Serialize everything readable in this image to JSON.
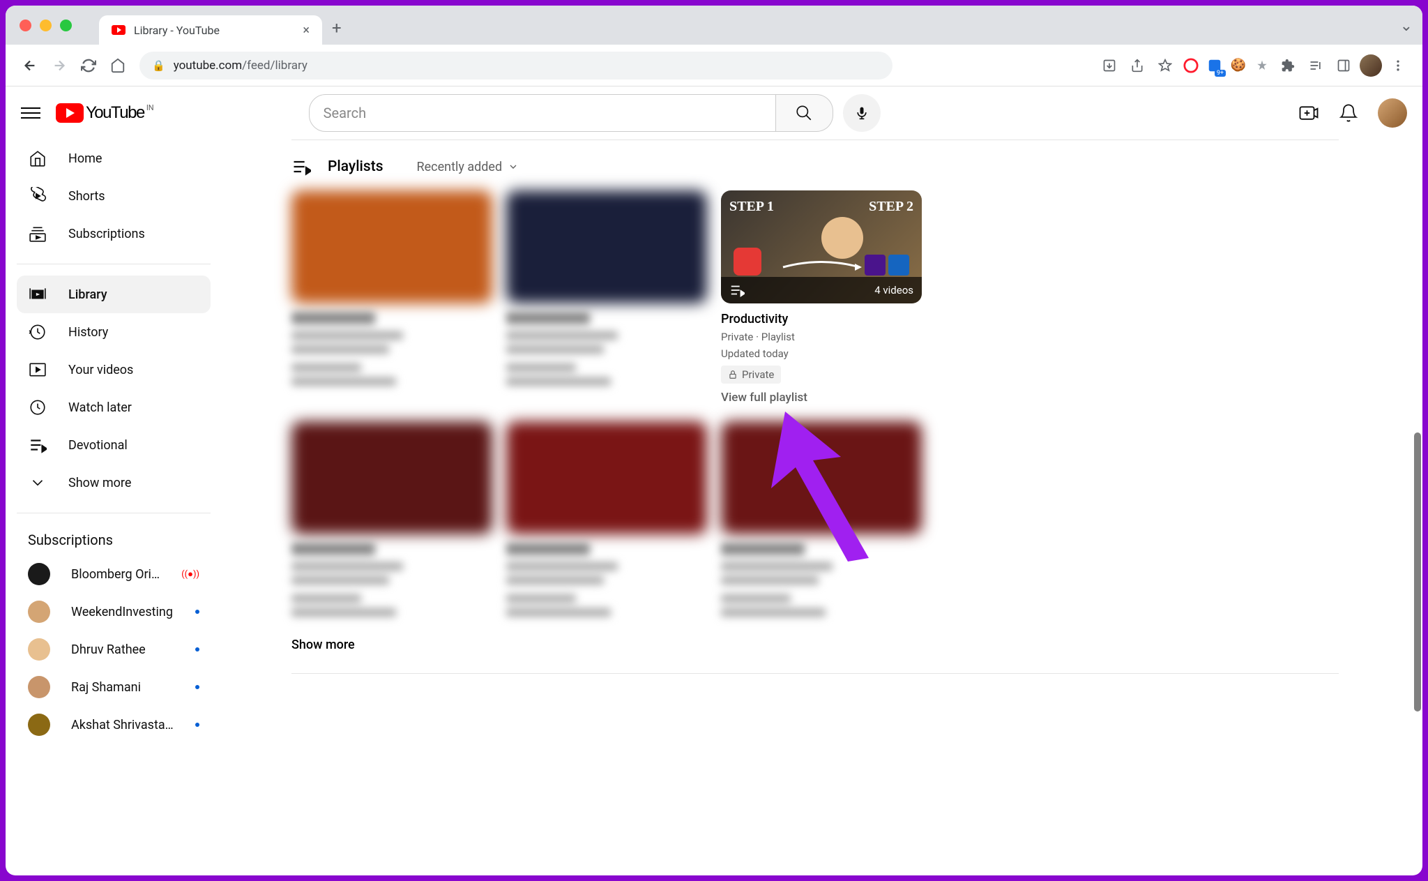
{
  "browser": {
    "tab_title": "Library - YouTube",
    "url_domain": "youtube.com",
    "url_path": "/feed/library"
  },
  "header": {
    "logo_text": "YouTube",
    "country_code": "IN",
    "search_placeholder": "Search"
  },
  "sidebar": {
    "nav": [
      {
        "icon": "home",
        "label": "Home"
      },
      {
        "icon": "shorts",
        "label": "Shorts"
      },
      {
        "icon": "subscriptions",
        "label": "Subscriptions"
      }
    ],
    "you": [
      {
        "icon": "library",
        "label": "Library",
        "active": true
      },
      {
        "icon": "history",
        "label": "History"
      },
      {
        "icon": "your-videos",
        "label": "Your videos"
      },
      {
        "icon": "watch-later",
        "label": "Watch later"
      },
      {
        "icon": "playlist",
        "label": "Devotional"
      },
      {
        "icon": "chevron-down",
        "label": "Show more"
      }
    ],
    "subs_heading": "Subscriptions",
    "subs": [
      {
        "name": "Bloomberg Origi...",
        "color": "#1a1a1a",
        "status": "live"
      },
      {
        "name": "WeekendInvesting",
        "color": "#d4a574",
        "status": "new"
      },
      {
        "name": "Dhruv Rathee",
        "color": "#e8c090",
        "status": "new"
      },
      {
        "name": "Raj Shamani",
        "color": "#c8956b",
        "status": "new"
      },
      {
        "name": "Akshat Shrivasta...",
        "color": "#8b6914",
        "status": "new"
      }
    ]
  },
  "main": {
    "section_title": "Playlists",
    "sort_label": "Recently added",
    "show_more": "Show more",
    "playlists_row1": [
      {
        "blur": true,
        "thumb_color": "#c25a1a"
      },
      {
        "blur": true,
        "thumb_color": "#1a1f3a"
      },
      {
        "blur": false,
        "title": "Productivity",
        "meta1": "Private · Playlist",
        "meta2": "Updated today",
        "privacy": "Private",
        "view_link": "View full playlist",
        "video_count": "4 videos",
        "step1": "STEP 1",
        "step2": "STEP 2"
      }
    ],
    "playlists_row2": [
      {
        "blur": true,
        "thumb_color": "#5a1515"
      },
      {
        "blur": true,
        "thumb_color": "#7a1515"
      },
      {
        "blur": true,
        "thumb_color": "#6a1515"
      }
    ]
  }
}
